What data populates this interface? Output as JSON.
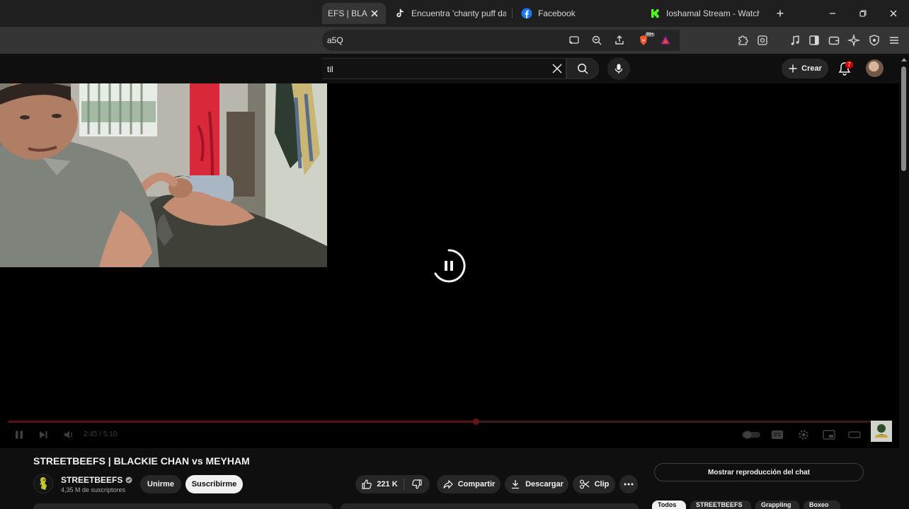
{
  "browser": {
    "tabs": [
      {
        "title": "EFS | BLA",
        "active": true,
        "favicon": "youtube-icon"
      },
      {
        "title": "Encuentra 'chanty puff dad",
        "active": false,
        "favicon": "tiktok-icon"
      },
      {
        "title": "Facebook",
        "active": false,
        "favicon": "facebook-icon"
      },
      {
        "title": "Ioshamal Stream - Watch L",
        "active": false,
        "favicon": "kick-icon"
      }
    ],
    "new_tab_label": "+",
    "url_fragment": "a5Q",
    "shields_badge": "99+"
  },
  "youtube": {
    "search_value": "til",
    "create_label": "Crear",
    "notification_count": "7"
  },
  "player": {
    "state": "paused-loading",
    "time_display": "2:45 / 5:10",
    "progress_fraction": 0.53
  },
  "video": {
    "title": "STREETBEEFS | BLACKIE CHAN vs MEYHAM",
    "channel": {
      "name": "STREETBEEFS",
      "verified": true,
      "subscribers": "4,35 M de suscriptores"
    },
    "join_label": "Unirme",
    "subscribe_label": "Suscribirme",
    "likes": "221 K",
    "share_label": "Compartir",
    "download_label": "Descargar",
    "clip_label": "Clip",
    "chat_replay_label": "Mostrar reproducción del chat"
  },
  "chips": [
    {
      "label": "Todos",
      "selected": true
    },
    {
      "label": "STREETBEEFS",
      "selected": false
    },
    {
      "label": "Grappling",
      "selected": false
    },
    {
      "label": "Boxeo",
      "selected": false
    }
  ],
  "colors": {
    "background": "#0f0f0f",
    "accent_red": "#cc0000",
    "pill": "#272727",
    "browser_frame": "#1f1f1f"
  }
}
